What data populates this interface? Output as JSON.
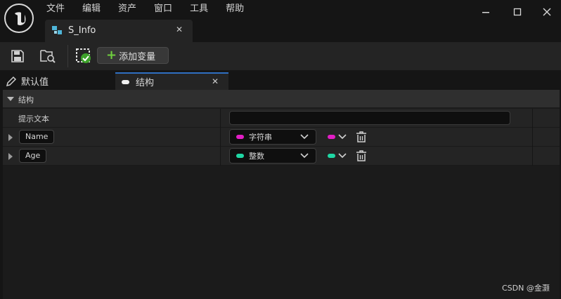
{
  "menu": [
    "文件",
    "编辑",
    "资产",
    "窗口",
    "工具",
    "帮助"
  ],
  "document_tab": {
    "label": "S_Info",
    "close": "✕"
  },
  "window_controls": {
    "minimize": "—",
    "maximize": "☐",
    "close": "✕"
  },
  "toolbar": {
    "add_variable_label": "添加变量"
  },
  "panel_tabs": [
    {
      "label": "默认值"
    },
    {
      "label": "结构",
      "close": "✕"
    }
  ],
  "structure": {
    "section_title": "结构",
    "tooltip_label": "提示文本",
    "tooltip_value": "",
    "members": [
      {
        "name": "Name",
        "type": "字符串",
        "color": "#e21ec5"
      },
      {
        "name": "Age",
        "type": "整数",
        "color": "#1fd7a4"
      }
    ]
  },
  "watermark": "CSDN @金灏",
  "colors": {
    "accent_tab": "#2f6fc1",
    "add_plus": "#6fcf3e",
    "asset_icon": "#4fb6d9"
  }
}
